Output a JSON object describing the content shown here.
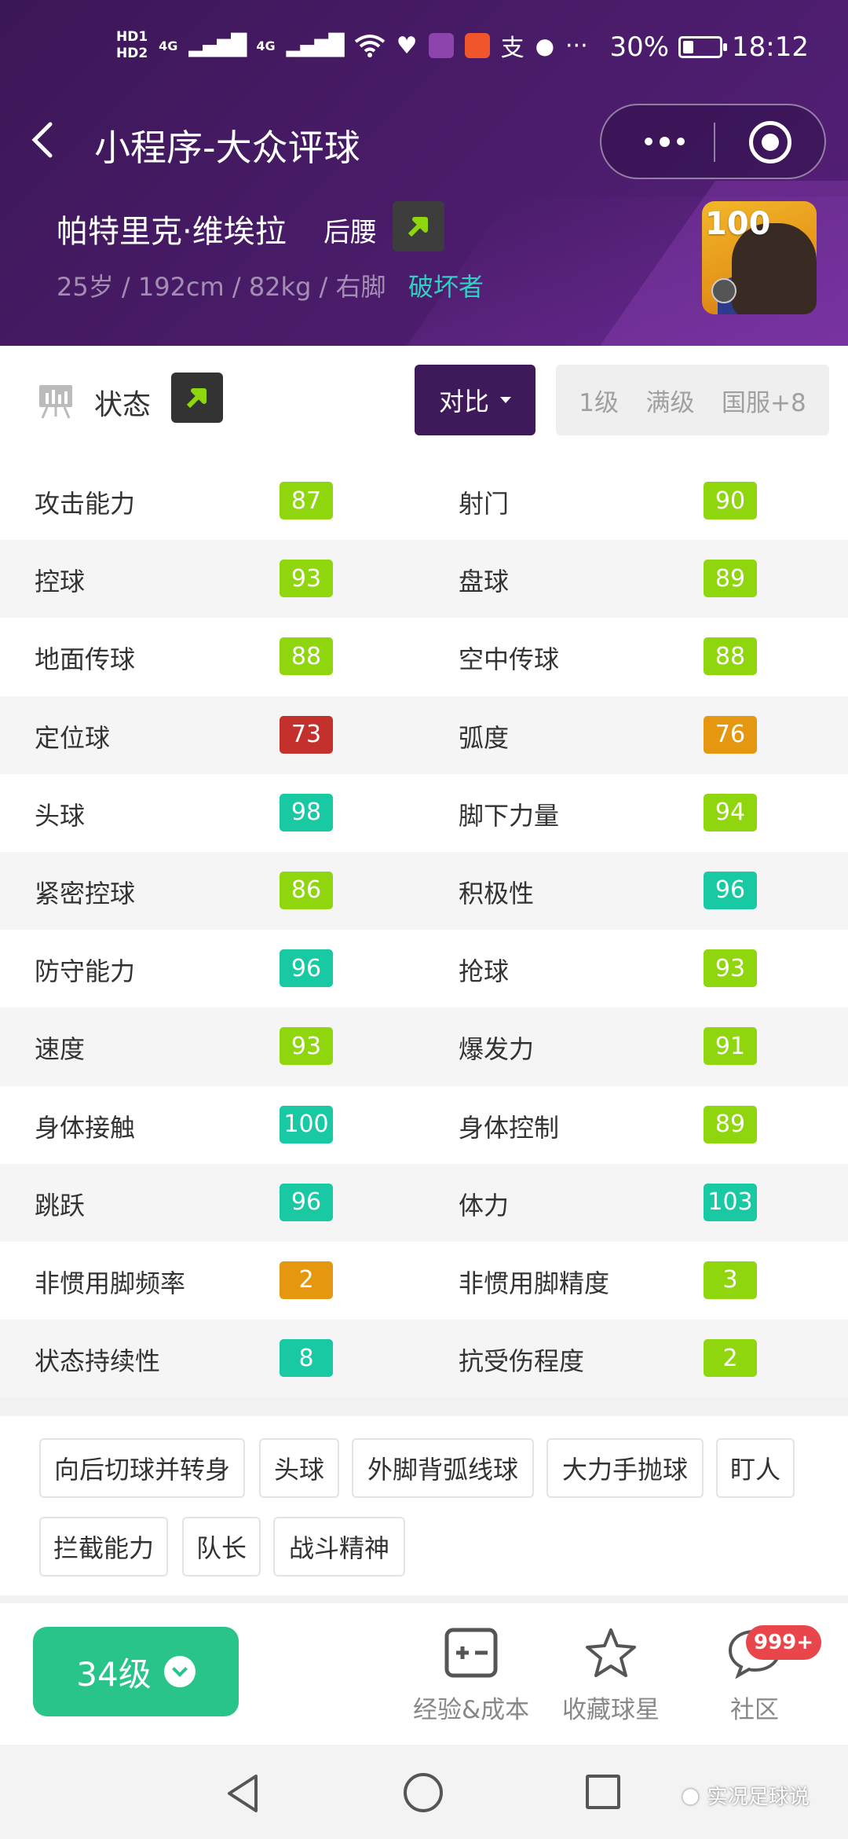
{
  "status_bar": {
    "hd1": "HD1",
    "hd2": "HD2",
    "net1": "4G",
    "net2": "4G",
    "dots": "···",
    "battery_percent": "30%",
    "battery_level": 0.3,
    "time": "18:12",
    "app_icons": [
      "heartbeat-app-icon",
      "video-app-icon",
      "player-app-icon",
      "alipay-icon",
      "wechat-icon"
    ]
  },
  "nav": {
    "title": "小程序-大众评球"
  },
  "player": {
    "name": "帕特里克·维埃拉",
    "position": "后腰",
    "info": "25岁 / 192cm / 82kg / 右脚",
    "style": "破坏者",
    "rating": "100"
  },
  "section": {
    "label": "状态",
    "compare_label": "对比",
    "levels": [
      "1级",
      "满级",
      "国服+8"
    ]
  },
  "colors": {
    "header_bg": "#4a1c6a",
    "compare_bg": "#3f1a5a",
    "accent_green": "#29c489",
    "stat_lime": "#8fd60f",
    "stat_teal": "#19c9a3",
    "stat_red": "#c4302b",
    "stat_orange": "#e5980f",
    "badge_red": "#e8464a",
    "style_teal": "#2fd0c0"
  },
  "stats": [
    {
      "left": {
        "name": "攻击能力",
        "value": "87",
        "color": "#8fd60f"
      },
      "right": {
        "name": "射门",
        "value": "90",
        "color": "#8fd60f"
      }
    },
    {
      "left": {
        "name": "控球",
        "value": "93",
        "color": "#8fd60f"
      },
      "right": {
        "name": "盘球",
        "value": "89",
        "color": "#8fd60f"
      }
    },
    {
      "left": {
        "name": "地面传球",
        "value": "88",
        "color": "#8fd60f"
      },
      "right": {
        "name": "空中传球",
        "value": "88",
        "color": "#8fd60f"
      }
    },
    {
      "left": {
        "name": "定位球",
        "value": "73",
        "color": "#c4302b"
      },
      "right": {
        "name": "弧度",
        "value": "76",
        "color": "#e5980f"
      }
    },
    {
      "left": {
        "name": "头球",
        "value": "98",
        "color": "#19c9a3"
      },
      "right": {
        "name": "脚下力量",
        "value": "94",
        "color": "#8fd60f"
      }
    },
    {
      "left": {
        "name": "紧密控球",
        "value": "86",
        "color": "#8fd60f"
      },
      "right": {
        "name": "积极性",
        "value": "96",
        "color": "#19c9a3"
      }
    },
    {
      "left": {
        "name": "防守能力",
        "value": "96",
        "color": "#19c9a3"
      },
      "right": {
        "name": "抢球",
        "value": "93",
        "color": "#8fd60f"
      }
    },
    {
      "left": {
        "name": "速度",
        "value": "93",
        "color": "#8fd60f"
      },
      "right": {
        "name": "爆发力",
        "value": "91",
        "color": "#8fd60f"
      }
    },
    {
      "left": {
        "name": "身体接触",
        "value": "100",
        "color": "#19c9a3"
      },
      "right": {
        "name": "身体控制",
        "value": "89",
        "color": "#8fd60f"
      }
    },
    {
      "left": {
        "name": "跳跃",
        "value": "96",
        "color": "#19c9a3"
      },
      "right": {
        "name": "体力",
        "value": "103",
        "color": "#19c9a3"
      }
    },
    {
      "left": {
        "name": "非惯用脚频率",
        "value": "2",
        "color": "#e5980f"
      },
      "right": {
        "name": "非惯用脚精度",
        "value": "3",
        "color": "#8fd60f"
      }
    },
    {
      "left": {
        "name": "状态持续性",
        "value": "8",
        "color": "#19c9a3"
      },
      "right": {
        "name": "抗受伤程度",
        "value": "2",
        "color": "#8fd60f"
      }
    }
  ],
  "skills": [
    "向后切球并转身",
    "头球",
    "外脚背弧线球",
    "大力手抛球",
    "盯人",
    "拦截能力",
    "队长",
    "战斗精神"
  ],
  "bottom": {
    "level_label": "34级",
    "exp_label": "经验&成本",
    "favorite_label": "收藏球星",
    "community_label": "社区",
    "community_badge": "999+"
  },
  "watermark": "实况足球说"
}
